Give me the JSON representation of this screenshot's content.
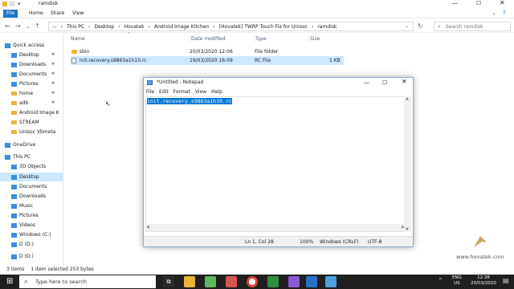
{
  "window": {
    "title": "ramdisk"
  },
  "ribbon": {
    "tabs": [
      "File",
      "Home",
      "Share",
      "View"
    ]
  },
  "address": {
    "crumbs": [
      "This PC",
      "Desktop",
      "Hovatek",
      "Android Image Kitchen",
      "[Hovatek] TWRP Touch Fix for Unisoc",
      "ramdisk"
    ]
  },
  "search": {
    "placeholder": "Search ramdisk"
  },
  "sidebar": {
    "items": [
      {
        "label": "Quick access",
        "icon": "star-icon"
      },
      {
        "label": "Desktop",
        "icon": "desktop-icon",
        "pinned": true
      },
      {
        "label": "Downloads",
        "icon": "downloads-icon",
        "pinned": true
      },
      {
        "label": "Documents",
        "icon": "documents-icon",
        "pinned": true
      },
      {
        "label": "Pictures",
        "icon": "pictures-icon",
        "pinned": true
      },
      {
        "label": "home",
        "icon": "folder-icon",
        "pinned": true
      },
      {
        "label": "adb",
        "icon": "folder-icon",
        "pinned": true
      },
      {
        "label": "Android Image K",
        "icon": "folder-icon"
      },
      {
        "label": "STREAM",
        "icon": "folder-icon"
      },
      {
        "label": "Unisoc Vbmeta",
        "icon": "folder-icon"
      },
      {
        "label": "OneDrive",
        "icon": "cloud-icon"
      },
      {
        "label": "This PC",
        "icon": "computer-icon"
      },
      {
        "label": "3D Objects",
        "icon": "3d-objects-icon"
      },
      {
        "label": "Desktop",
        "icon": "desktop-icon",
        "selected": true
      },
      {
        "label": "Documents",
        "icon": "documents-icon"
      },
      {
        "label": "Downloads",
        "icon": "downloads-icon"
      },
      {
        "label": "Music",
        "icon": "music-icon"
      },
      {
        "label": "Pictures",
        "icon": "pictures-icon"
      },
      {
        "label": "Videos",
        "icon": "videos-icon"
      },
      {
        "label": "Windows (C:)",
        "icon": "drive-icon"
      },
      {
        "label": "D (D:)",
        "icon": "drive-icon"
      },
      {
        "label": "D (D:)",
        "icon": "drive-icon"
      }
    ]
  },
  "columns": {
    "name": "Name",
    "date": "Date modified",
    "type": "Type",
    "size": "Size"
  },
  "files": [
    {
      "name": "sbin",
      "date": "20/03/2020 12:06",
      "type": "File folder",
      "size": ""
    },
    {
      "name": "init.recovery.s9863a1h10.rc",
      "date": "19/03/2020 16:09",
      "type": "RC File",
      "size": "1 KB",
      "selected": true
    }
  ],
  "statusbar": {
    "items": "3 items",
    "selected": "1 item selected  253 bytes"
  },
  "notepad": {
    "title": "*Untitled - Notepad",
    "menu": [
      "File",
      "Edit",
      "Format",
      "View",
      "Help"
    ],
    "content": "init.recovery.s9863a1h10.rc",
    "status": {
      "pos": "Ln 1, Col 28",
      "zoom": "100%",
      "eol": "Windows (CRLF)",
      "enc": "UTF-8"
    }
  },
  "taskbar": {
    "search": "Type here to search",
    "lang": "ENG",
    "region": "US",
    "time": "12:38",
    "date": "20/03/2020"
  },
  "watermark": {
    "text": "www.hovatek.com"
  }
}
